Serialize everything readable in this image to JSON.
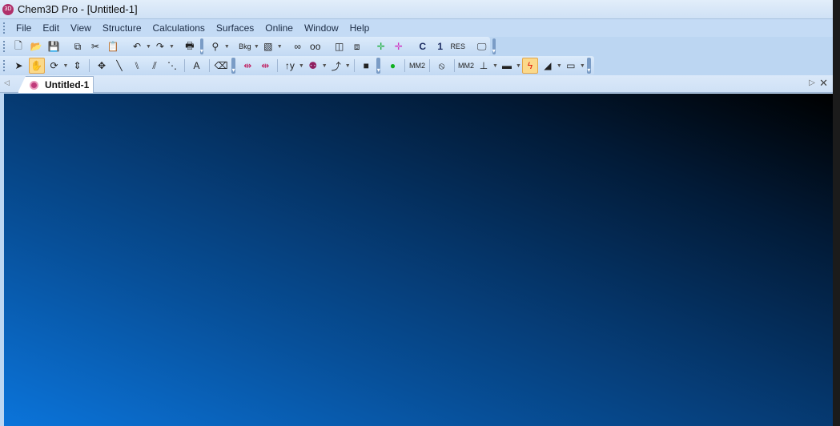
{
  "window": {
    "title": "Chem3D Pro - [Untitled-1]",
    "app_icon": "3D"
  },
  "menu": [
    "File",
    "Edit",
    "View",
    "Structure",
    "Calculations",
    "Surfaces",
    "Online",
    "Window",
    "Help"
  ],
  "toolbar1": [
    {
      "icon": "new-file-icon",
      "glyph": "🗋"
    },
    {
      "icon": "open-folder-icon",
      "glyph": "📂"
    },
    {
      "icon": "save-icon",
      "glyph": "💾"
    },
    {
      "sep": true
    },
    {
      "icon": "copy-icon",
      "glyph": "⧉"
    },
    {
      "icon": "cut-icon",
      "glyph": "✂"
    },
    {
      "icon": "paste-icon",
      "glyph": "📋"
    },
    {
      "sep": true
    },
    {
      "icon": "undo-icon",
      "glyph": "↶",
      "drop": true
    },
    {
      "icon": "redo-icon",
      "glyph": "↷",
      "drop": true
    },
    {
      "sep": true
    },
    {
      "icon": "print-icon",
      "glyph": "🖶"
    },
    {
      "overflow": true
    },
    {
      "icon": "bond-tool-icon",
      "glyph": "⚲",
      "drop": true
    },
    {
      "sep": true
    },
    {
      "icon": "background-color-icon",
      "glyph": "Bkg",
      "drop": true
    },
    {
      "icon": "gradient-icon",
      "glyph": "▧",
      "drop": true
    },
    {
      "sep": true
    },
    {
      "icon": "stereo-view-icon",
      "glyph": "∞"
    },
    {
      "icon": "glasses-icon",
      "glyph": "oo"
    },
    {
      "sep": true
    },
    {
      "icon": "box-icon",
      "glyph": "◫"
    },
    {
      "icon": "cubes-icon",
      "glyph": "⧈"
    },
    {
      "sep": true
    },
    {
      "icon": "move-m-icon",
      "glyph": "✛"
    },
    {
      "icon": "move-v-icon",
      "glyph": "✛"
    },
    {
      "sep": true
    },
    {
      "icon": "carbon-label-icon",
      "glyph": "C"
    },
    {
      "icon": "serial-number-icon",
      "glyph": "1"
    },
    {
      "icon": "residue-label-icon",
      "glyph": "RES"
    },
    {
      "sep": true
    },
    {
      "icon": "display-icon",
      "glyph": "🖵"
    },
    {
      "overflow": true
    }
  ],
  "toolbar2": [
    {
      "icon": "select-arrow-icon",
      "glyph": "➤"
    },
    {
      "icon": "hand-pan-icon",
      "glyph": "✋",
      "active": true
    },
    {
      "icon": "rotate-icon",
      "glyph": "⟳",
      "drop": true
    },
    {
      "icon": "zoom-translate-icon",
      "glyph": "⇕"
    },
    {
      "sep": true
    },
    {
      "icon": "move-atoms-icon",
      "glyph": "✥"
    },
    {
      "icon": "single-bond-icon",
      "glyph": "╲"
    },
    {
      "icon": "double-bond-icon",
      "glyph": "⑊"
    },
    {
      "icon": "triple-bond-icon",
      "glyph": "⫽"
    },
    {
      "icon": "dashed-bond-icon",
      "glyph": "⋱"
    },
    {
      "sep": true
    },
    {
      "icon": "text-tool-icon",
      "glyph": "A"
    },
    {
      "sep": true
    },
    {
      "icon": "eraser-icon",
      "glyph": "⌫"
    },
    {
      "overflow": true
    },
    {
      "icon": "measure-icon",
      "glyph": "⇹"
    },
    {
      "icon": "measure-alt-icon",
      "glyph": "⇹"
    },
    {
      "sep": true
    },
    {
      "icon": "axis-y-icon",
      "glyph": "↑y",
      "drop": true
    },
    {
      "icon": "atom-color-icon",
      "glyph": "⚉",
      "drop": true
    },
    {
      "icon": "fragment-icon",
      "glyph": "⤴",
      "drop": true
    },
    {
      "sep": true
    },
    {
      "icon": "stop-icon",
      "glyph": "■"
    },
    {
      "overflow": true
    },
    {
      "icon": "run-green-icon",
      "glyph": "●"
    },
    {
      "sep": true
    },
    {
      "icon": "mm2-minimize-icon",
      "glyph": "MM2"
    },
    {
      "sep": true
    },
    {
      "icon": "no-sign-icon",
      "glyph": "⦸"
    },
    {
      "sep": true
    },
    {
      "icon": "mm2-dynamics-icon",
      "glyph": "MM2"
    },
    {
      "icon": "ruler-icon",
      "glyph": "⊥",
      "drop": true
    },
    {
      "icon": "ruler-double-icon",
      "glyph": "▬",
      "drop": true
    },
    {
      "icon": "energy-icon",
      "glyph": "ϟ",
      "active": true
    },
    {
      "icon": "ramp-icon",
      "glyph": "◢",
      "drop": true
    },
    {
      "icon": "bar-icon",
      "glyph": "▭",
      "drop": true
    },
    {
      "overflow": true
    }
  ],
  "tabs": [
    {
      "label": "Untitled-1"
    }
  ],
  "colors": {
    "canvas_light": "#0b74da",
    "canvas_dark": "#000000",
    "accent": "#c03a7a"
  }
}
